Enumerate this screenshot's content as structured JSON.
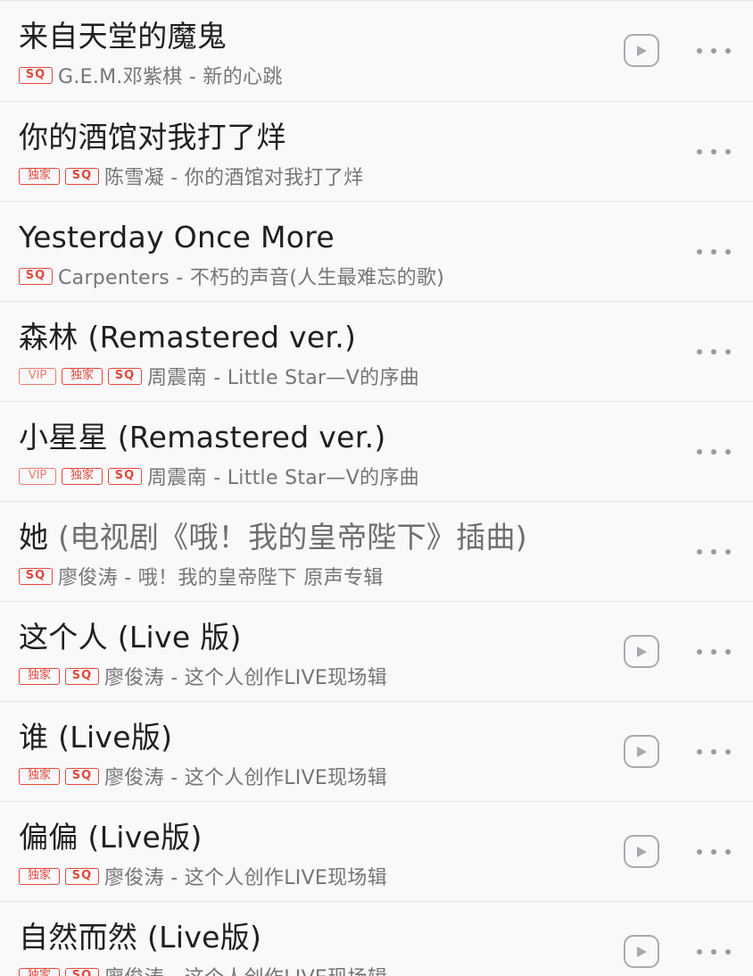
{
  "songs": [
    {
      "title": "来自天堂的魔鬼",
      "title_sub": "",
      "muted": false,
      "badges": [
        "SQ"
      ],
      "artist_album": "G.E.M.邓紫棋 - 新的心跳",
      "has_video": true
    },
    {
      "title": "你的酒馆对我打了烊",
      "title_sub": "",
      "muted": false,
      "badges": [
        "独家",
        "SQ"
      ],
      "artist_album": "陈雪凝 - 你的酒馆对我打了烊",
      "has_video": false
    },
    {
      "title": "Yesterday Once More",
      "title_sub": "",
      "muted": false,
      "badges": [
        "SQ"
      ],
      "artist_album": "Carpenters - 不朽的声音(人生最难忘的歌)",
      "has_video": false
    },
    {
      "title": "森林 (Remastered ver.)",
      "title_sub": "",
      "muted": false,
      "badges": [
        "VIP",
        "独家",
        "SQ"
      ],
      "artist_album": "周震南 - Little Star—V的序曲",
      "has_video": false
    },
    {
      "title": "小星星 (Remastered ver.)",
      "title_sub": "",
      "muted": false,
      "badges": [
        "VIP",
        "独家",
        "SQ"
      ],
      "artist_album": "周震南 - Little Star—V的序曲",
      "has_video": false
    },
    {
      "title": "她",
      "title_sub": " (电视剧《哦！我的皇帝陛下》插曲)",
      "muted": true,
      "badges": [
        "SQ"
      ],
      "artist_album": "廖俊涛 - 哦！我的皇帝陛下 原声专辑",
      "has_video": false
    },
    {
      "title": "这个人 (Live 版)",
      "title_sub": "",
      "muted": false,
      "badges": [
        "独家",
        "SQ"
      ],
      "artist_album": "廖俊涛 - 这个人创作LIVE现场辑",
      "has_video": true
    },
    {
      "title": "谁 (Live版)",
      "title_sub": "",
      "muted": false,
      "badges": [
        "独家",
        "SQ"
      ],
      "artist_album": "廖俊涛 - 这个人创作LIVE现场辑",
      "has_video": true
    },
    {
      "title": "偏偏 (Live版)",
      "title_sub": "",
      "muted": false,
      "badges": [
        "独家",
        "SQ"
      ],
      "artist_album": "廖俊涛 - 这个人创作LIVE现场辑",
      "has_video": true
    },
    {
      "title": "自然而然 (Live版)",
      "title_sub": "",
      "muted": false,
      "badges": [
        "独家",
        "SQ"
      ],
      "artist_album": "廖俊涛 - 这个人创作LIVE现场辑",
      "has_video": true
    }
  ],
  "icons": {
    "video": "play-video-icon",
    "more": "more-options-icon"
  },
  "colors": {
    "badge_red": "#e0483b",
    "badge_vip": "#ee7a6f",
    "title": "#1f1f1f",
    "subtitle": "#757575",
    "icon_gray": "#9b9b9f",
    "background": "#f9f9fb"
  }
}
